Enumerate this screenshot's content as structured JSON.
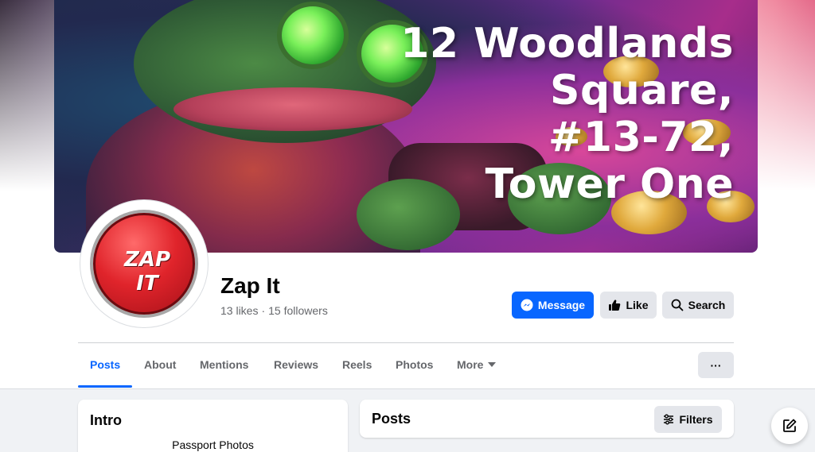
{
  "cover": {
    "address_lines": [
      "12 Woodlands",
      "Square,",
      "#13-72,",
      "Tower One"
    ]
  },
  "avatar": {
    "logo_text_line1": "ZAP",
    "logo_text_line2": "IT"
  },
  "header": {
    "page_name": "Zap It",
    "likes": "13 likes",
    "separator": "·",
    "followers": "15 followers"
  },
  "actions": {
    "message_label": "Message",
    "like_label": "Like",
    "search_label": "Search",
    "message_icon": "messenger-icon",
    "like_icon": "thumbs-up-icon",
    "search_icon": "search-icon"
  },
  "tabs": [
    {
      "label": "Posts",
      "active": true
    },
    {
      "label": "About",
      "active": false
    },
    {
      "label": "Mentions",
      "active": false
    },
    {
      "label": "Reviews",
      "active": false
    },
    {
      "label": "Reels",
      "active": false
    },
    {
      "label": "Photos",
      "active": false
    },
    {
      "label": "More",
      "active": false
    }
  ],
  "more_menu": {
    "label": "···"
  },
  "intro": {
    "title": "Intro",
    "category": "Passport Photos"
  },
  "posts": {
    "title": "Posts",
    "filters_label": "Filters"
  },
  "colors": {
    "accent": "#0866ff",
    "secondary_button": "#e4e6eb",
    "muted_text": "#65676b",
    "background": "#f0f2f5"
  }
}
